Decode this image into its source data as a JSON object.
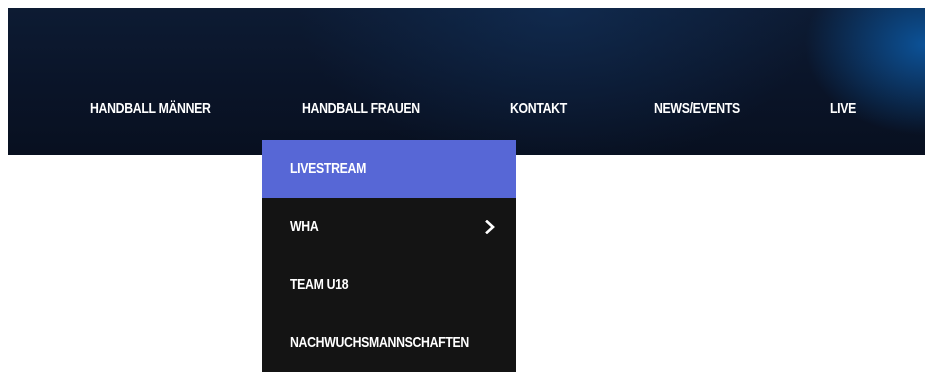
{
  "nav": {
    "items": [
      {
        "label": "HANDBALL MÄNNER"
      },
      {
        "label": "HANDBALL FRAUEN"
      },
      {
        "label": "KONTAKT"
      },
      {
        "label": "NEWS/EVENTS"
      },
      {
        "label": "LIVE"
      }
    ]
  },
  "dropdown": {
    "items": [
      {
        "label": "LIVESTREAM",
        "state": "hover"
      },
      {
        "label": "WHA",
        "has_submenu": true,
        "icon": "chevron-right-icon"
      },
      {
        "label": "TEAM U18"
      },
      {
        "label": "NACHWUCHSMANNSCHAFTEN"
      }
    ]
  },
  "colors": {
    "nav_background": "#0a1428",
    "nav_glow": "#0c5caa",
    "dropdown_background": "#141414",
    "dropdown_active": "#5767d6",
    "text": "#ffffff"
  }
}
